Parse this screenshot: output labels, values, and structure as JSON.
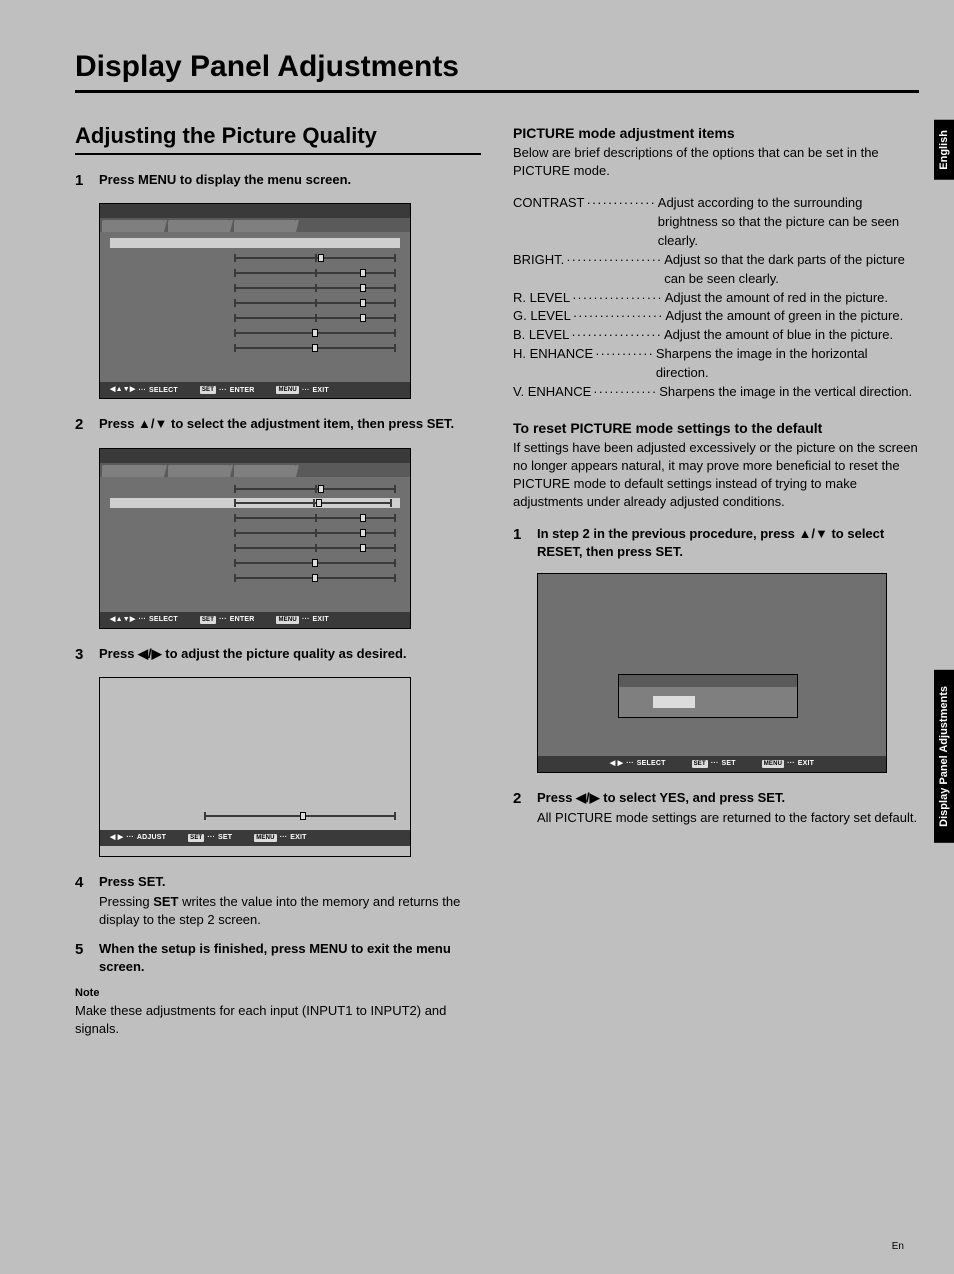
{
  "page_title": "Display Panel Adjustments",
  "section_title": "Adjusting the Picture Quality",
  "left_steps": [
    {
      "num": "1",
      "bold": "Press MENU to display the menu screen."
    },
    {
      "num": "2",
      "bold": "Press ▲/▼ to select the adjustment item, then press SET."
    },
    {
      "num": "3",
      "bold": "Press ◀/▶ to adjust the picture quality as desired."
    },
    {
      "num": "4",
      "bold": "Press SET.",
      "plain_prefix": "Pressing ",
      "plain_strong": "SET",
      "plain_suffix": " writes the value into the memory and returns the display to the step 2 screen."
    },
    {
      "num": "5",
      "bold": "When the setup is finished, press MENU to exit the menu screen."
    }
  ],
  "note_label": "Note",
  "note_text": "Make these adjustments for each input (INPUT1 to INPUT2) and signals.",
  "right_heading": "PICTURE mode adjustment items",
  "right_intro": "Below are brief descriptions of the options that can be set in the PICTURE mode.",
  "defs": [
    {
      "term": "CONTRAST",
      "desc": "Adjust according to the surrounding brightness so that the picture can be seen clearly."
    },
    {
      "term": "BRIGHT.",
      "desc": "Adjust so that the dark parts of the picture can be seen clearly."
    },
    {
      "term": "R. LEVEL",
      "desc": "Adjust the amount of red in the picture."
    },
    {
      "term": "G. LEVEL",
      "desc": "Adjust the amount of green in the picture."
    },
    {
      "term": "B. LEVEL",
      "desc": "Adjust the amount of blue in the picture."
    },
    {
      "term": "H. ENHANCE",
      "desc": "Sharpens the image in the horizontal direction."
    },
    {
      "term": "V. ENHANCE",
      "desc": "Sharpens the image in the vertical direction."
    }
  ],
  "reset_heading": "To reset PICTURE mode settings to the default",
  "reset_para": "If settings have been adjusted excessively or the picture on the screen no longer appears natural, it may prove more beneficial to reset the PICTURE mode to default settings instead of trying to make adjustments under already adjusted conditions.",
  "reset_steps": [
    {
      "num": "1",
      "bold": "In step 2 in the previous procedure, press ▲/▼ to select RESET, then press SET."
    },
    {
      "num": "2",
      "bold": "Press ◀/▶ to select YES, and press SET.",
      "plain": "All PICTURE mode settings are returned to the factory set default."
    }
  ],
  "footer": {
    "select": "SELECT",
    "enter": "ENTER",
    "exit": "EXIT",
    "adjust": "ADJUST",
    "set": "SET",
    "set_key": "SET",
    "menu_key": "MENU",
    "arrows4": "◀▲▼▶",
    "arrows2": "◀ ▶",
    "dots": "···"
  },
  "sidetab_lang": "English",
  "sidetab_section": "Display Panel Adjustments",
  "page_lang_footer": "En"
}
